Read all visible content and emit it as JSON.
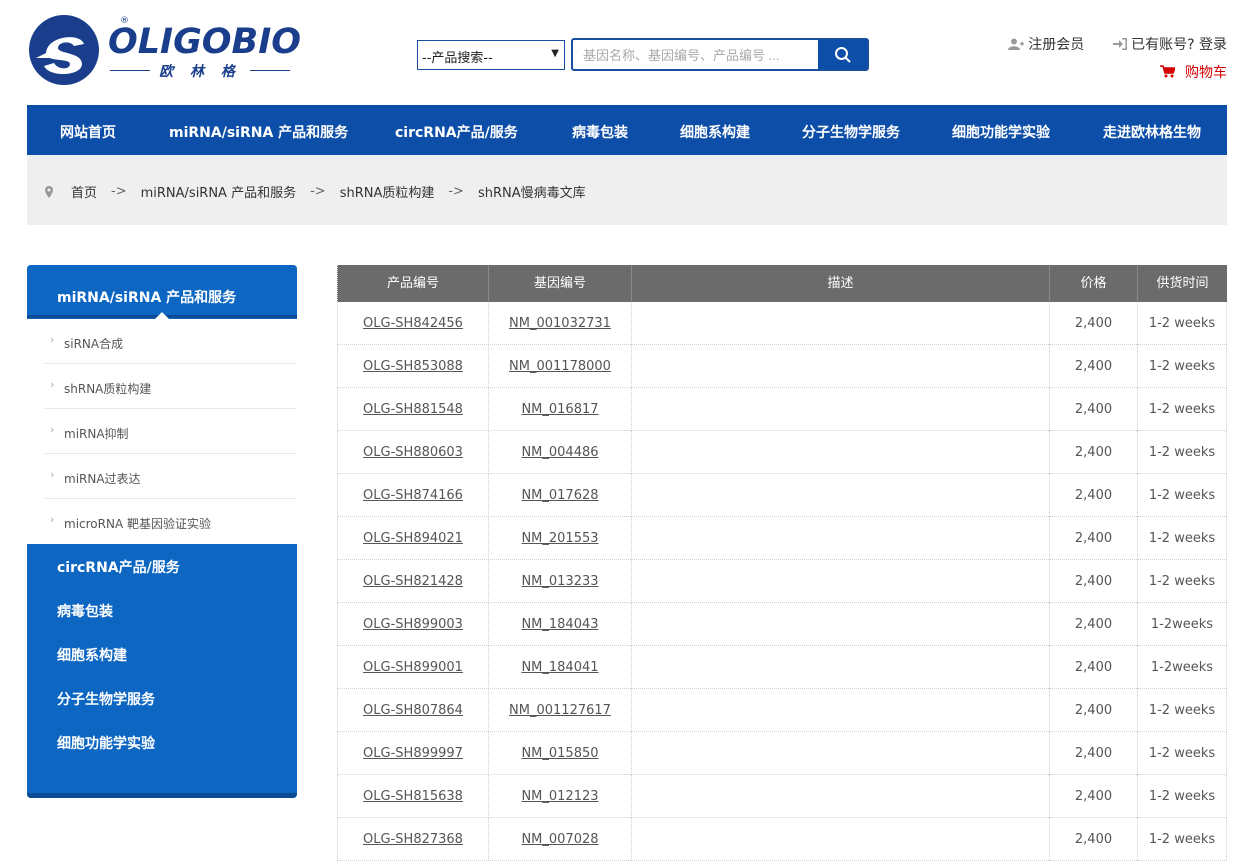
{
  "logo": {
    "name": "OLIGOBIO",
    "sub": "欧 林 格",
    "reg": "®"
  },
  "search": {
    "select_label": "--产品搜索--",
    "placeholder": "基因名称、基因编号、产品编号 ..."
  },
  "top_links": {
    "register": "注册会员",
    "login": "已有账号? 登录",
    "cart": "购物车"
  },
  "nav": [
    "网站首页",
    "miRNA/siRNA 产品和服务",
    "circRNA产品/服务",
    "病毒包装",
    "细胞系构建",
    "分子生物学服务",
    "细胞功能学实验",
    "走进欧林格生物"
  ],
  "breadcrumb": {
    "items": [
      "首页",
      "miRNA/siRNA 产品和服务",
      "shRNA质粒构建",
      "shRNA慢病毒文库"
    ],
    "separator": "->"
  },
  "sidebar": {
    "active": "miRNA/siRNA 产品和服务",
    "sub_items": [
      "siRNA合成",
      "shRNA质粒构建",
      "miRNA抑制",
      "miRNA过表达",
      "microRNA 靶基因验证实验"
    ],
    "main_items": [
      "circRNA产品/服务",
      "病毒包装",
      "细胞系构建",
      "分子生物学服务",
      "细胞功能学实验"
    ]
  },
  "table": {
    "headers": [
      "产品编号",
      "基因编号",
      "描述",
      "价格",
      "供货时间"
    ],
    "rows": [
      [
        "OLG-SH842456",
        "NM_001032731",
        "",
        "2,400",
        "1-2 weeks"
      ],
      [
        "OLG-SH853088",
        "NM_001178000",
        "",
        "2,400",
        "1-2 weeks"
      ],
      [
        "OLG-SH881548",
        "NM_016817",
        "",
        "2,400",
        "1-2 weeks"
      ],
      [
        "OLG-SH880603",
        "NM_004486",
        "",
        "2,400",
        "1-2 weeks"
      ],
      [
        "OLG-SH874166",
        "NM_017628",
        "",
        "2,400",
        "1-2 weeks"
      ],
      [
        "OLG-SH894021",
        "NM_201553",
        "",
        "2,400",
        "1-2 weeks"
      ],
      [
        "OLG-SH821428",
        "NM_013233",
        "",
        "2,400",
        "1-2 weeks"
      ],
      [
        "OLG-SH899003",
        "NM_184043",
        "",
        "2,400",
        "1-2weeks"
      ],
      [
        "OLG-SH899001",
        "NM_184041",
        "",
        "2,400",
        "1-2weeks"
      ],
      [
        "OLG-SH807864",
        "NM_001127617",
        "",
        "2,400",
        "1-2 weeks"
      ],
      [
        "OLG-SH899997",
        "NM_015850",
        "",
        "2,400",
        "1-2 weeks"
      ],
      [
        "OLG-SH815638",
        "NM_012123",
        "",
        "2,400",
        "1-2 weeks"
      ],
      [
        "OLG-SH827368",
        "NM_007028",
        "",
        "2,400",
        "1-2 weeks"
      ]
    ]
  },
  "colors": {
    "brand": "#0d4ea8",
    "sidebar": "#0d66c2",
    "cart": "#d40000",
    "table_header": "#6b6b6b"
  }
}
